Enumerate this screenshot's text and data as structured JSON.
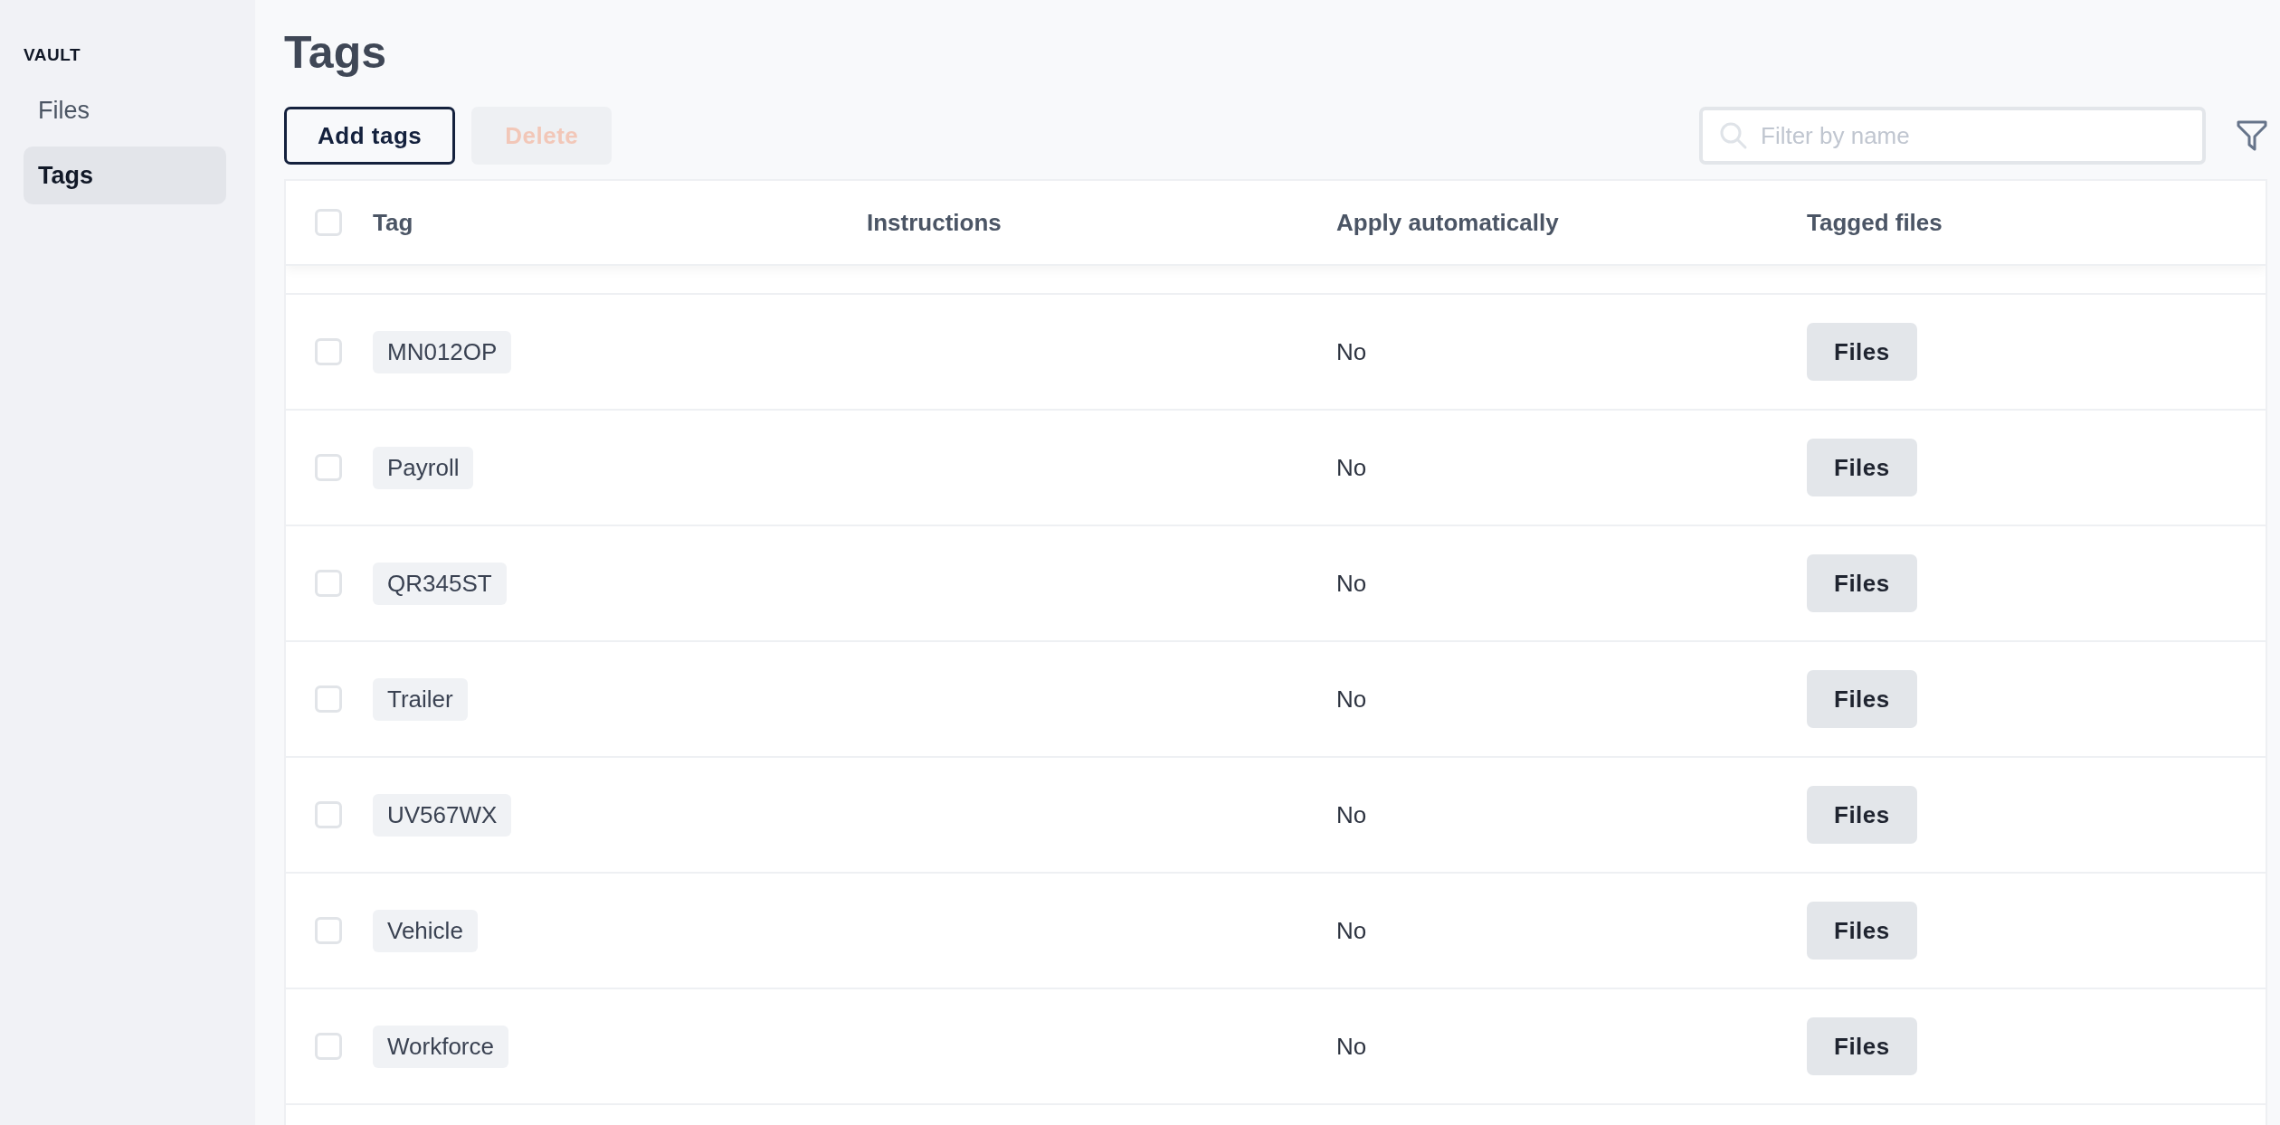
{
  "sidebar": {
    "section": "VAULT",
    "items": [
      {
        "label": "Files",
        "selected": false
      },
      {
        "label": "Tags",
        "selected": true
      }
    ]
  },
  "page_title": "Tags",
  "toolbar": {
    "buttons": [
      {
        "label": "Add tags",
        "disabled": false
      },
      {
        "label": "Delete",
        "disabled": true
      }
    ],
    "search": {
      "placeholder": "Filter by name"
    }
  },
  "table": {
    "select_all": {
      "checked": false
    },
    "columns": [
      "Tag",
      "Instructions",
      "Apply automatically",
      "Tagged files"
    ],
    "rows": [
      {
        "checked": false,
        "tag": "MN012OP",
        "apply_automatically": "No",
        "tagged_files": "Files"
      },
      {
        "checked": false,
        "tag": "Payroll",
        "apply_automatically": "No",
        "tagged_files": "Files"
      },
      {
        "checked": false,
        "tag": "QR345ST",
        "apply_automatically": "No",
        "tagged_files": "Files"
      },
      {
        "checked": false,
        "tag": "Trailer",
        "apply_automatically": "No",
        "tagged_files": "Files"
      },
      {
        "checked": false,
        "tag": "UV567WX",
        "apply_automatically": "No",
        "tagged_files": "Files"
      },
      {
        "checked": false,
        "tag": "Vehicle",
        "apply_automatically": "No",
        "tagged_files": "Files"
      },
      {
        "checked": false,
        "tag": "Workforce",
        "apply_automatically": "No",
        "tagged_files": "Files"
      }
    ]
  }
}
